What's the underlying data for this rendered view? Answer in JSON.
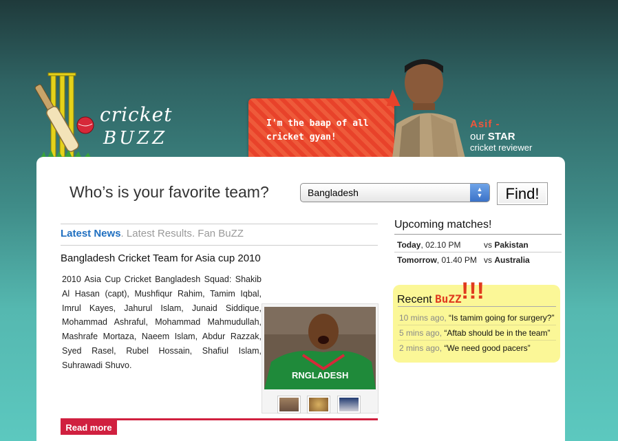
{
  "logo": {
    "line1": "cricket",
    "line2": "BUZZ"
  },
  "bubble": {
    "text": "I'm the baap of all cricket gyan!"
  },
  "star": {
    "name": "Asif -",
    "line2_prefix": "our ",
    "line2_strong": "STAR",
    "line3": "cricket reviewer"
  },
  "favorite": {
    "label": "Who’s is your favorite team?",
    "selected": "Bangladesh",
    "button": "Find!"
  },
  "tabs": [
    {
      "label": "Latest News",
      "active": true
    },
    {
      "label": "Latest Results",
      "active": false
    },
    {
      "label": "Fan BuZZ",
      "active": false
    }
  ],
  "separator": ".",
  "article": {
    "title": "Bangladesh Cricket Team for Asia cup 2010",
    "body": "2010 Asia Cup Cricket Bangladesh Squad: Shakib Al Hasan (capt), Mushfiqur Rahim, Tamim Iqbal, Imrul Kayes, Jahurul Islam, Junaid Siddique, Mohammad Ashraful, Mohammad Mahmudullah, Mashrafe Mortaza, Naeem Islam, Abdur Razzak, Syed Rasel, Rubel Hossain, Shafiul Islam, Suhrawadi Shuvo.",
    "read_more": "Read more",
    "photo_text": "RNGLADESH"
  },
  "upcoming": {
    "title": "Upcoming matches!",
    "matches": [
      {
        "day": "Today",
        "time": ", 02.10 PM",
        "vs": "vs ",
        "team": "Pakistan"
      },
      {
        "day": "Tomorrow",
        "time": ", 01.40 PM",
        "vs": "vs ",
        "team": "Australia"
      }
    ]
  },
  "buzz": {
    "title_prefix": "Recent ",
    "title_word": "BuZZ",
    "bang": "!!!",
    "items": [
      {
        "time": "10 mins ago,",
        "text": " “Is tamim going for surgery?”"
      },
      {
        "time": "5 mins ago,",
        "text": " “Aftab should be in the team”"
      },
      {
        "time": "2 mins ago,",
        "text": " “We need good pacers”"
      }
    ]
  },
  "colors": {
    "accent_blue": "#1f6fc0",
    "accent_red": "#d0203f",
    "buzz_yellow": "#fbf797",
    "bubble_red": "#e8422a"
  }
}
